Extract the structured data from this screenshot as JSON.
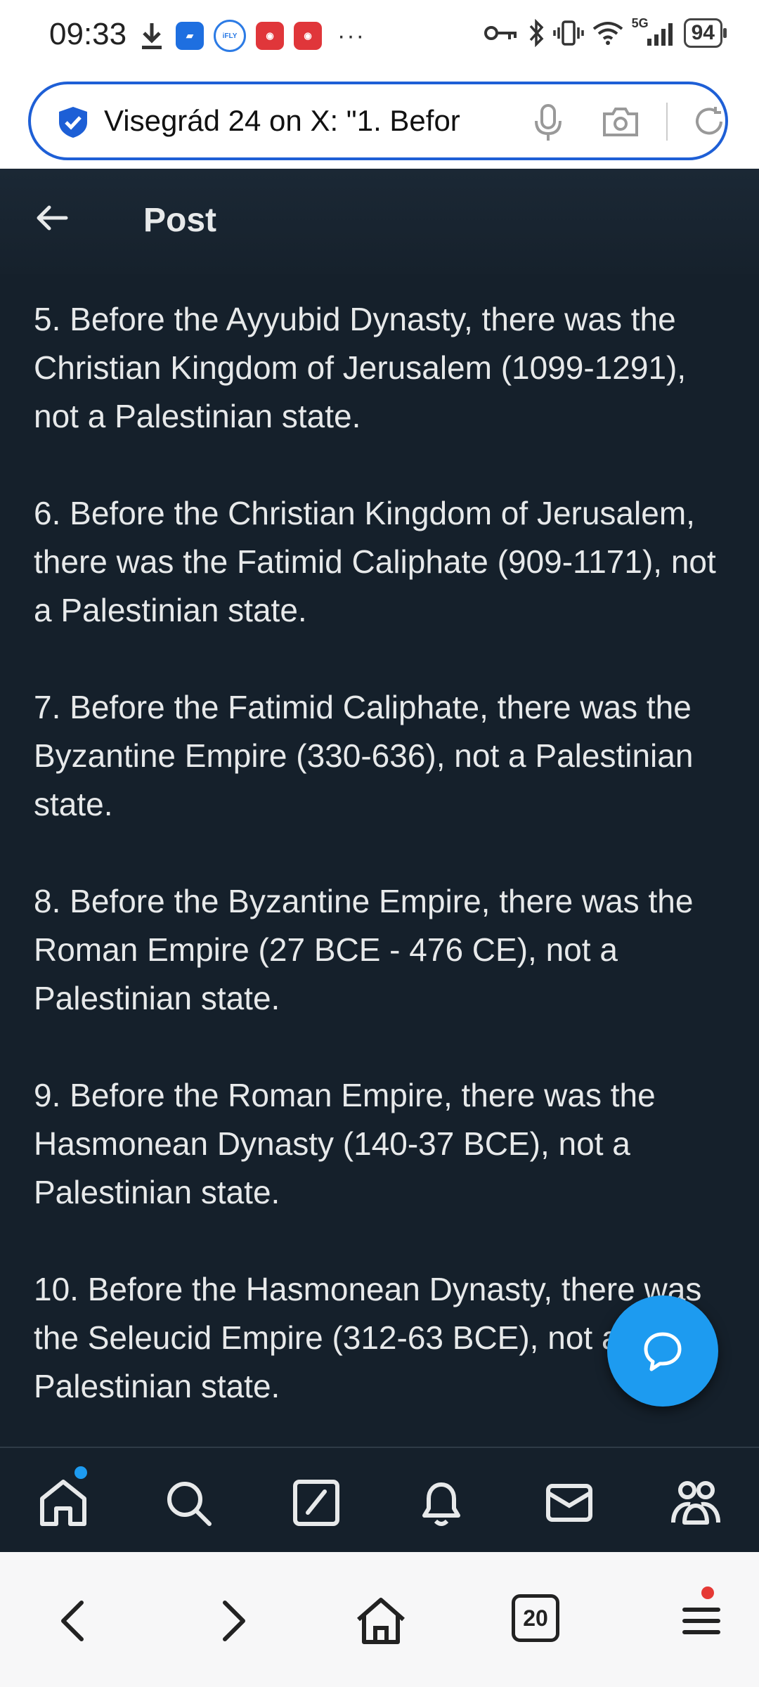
{
  "status_bar": {
    "time": "09:33",
    "network": "5G",
    "battery": "94",
    "left_icons": [
      "download-icon",
      "app-bird-icon",
      "ifly-icon",
      "app-red-icon",
      "app-red-icon-2"
    ],
    "right_icons": [
      "key-icon",
      "bluetooth-icon",
      "vibrate-icon",
      "wifi-icon",
      "signal-icon"
    ]
  },
  "url_bar": {
    "text": "Visegrád 24 on X: \"1. Befor",
    "shield_color": "#1d5fd6"
  },
  "post": {
    "title": "Post",
    "paragraphs": [
      "5. Before the Ayyubid Dynasty, there was the Christian Kingdom of Jerusalem (1099-1291), not a Palestinian state.",
      "6. Before the Christian Kingdom of Jerusalem, there was the Fatimid Caliphate (909-1171), not a Palestinian state.",
      "7. Before the Fatimid Caliphate, there was the Byzantine Empire (330-636), not a Palestinian state.",
      "8. Before the Byzantine Empire, there was the Roman Empire (27 BCE - 476 CE), not a Palestinian state.",
      "9. Before the Roman Empire, there was the Hasmonean Dynasty (140-37 BCE), not a Palestinian state.",
      "10. Before the Hasmonean Dynasty, there was the Seleucid Empire (312-63 BCE), not a Palestinian state."
    ]
  },
  "x_nav": [
    "home-icon",
    "search-icon",
    "grok-icon",
    "notifications-icon",
    "messages-icon",
    "communities-icon"
  ],
  "browser_nav": {
    "tab_count": "20",
    "items": [
      "back-icon",
      "forward-icon",
      "home-icon",
      "tabs-icon",
      "menu-icon"
    ]
  },
  "colors": {
    "background": "#15202b",
    "text": "#e7e9ea",
    "accent": "#1d9bf0"
  }
}
